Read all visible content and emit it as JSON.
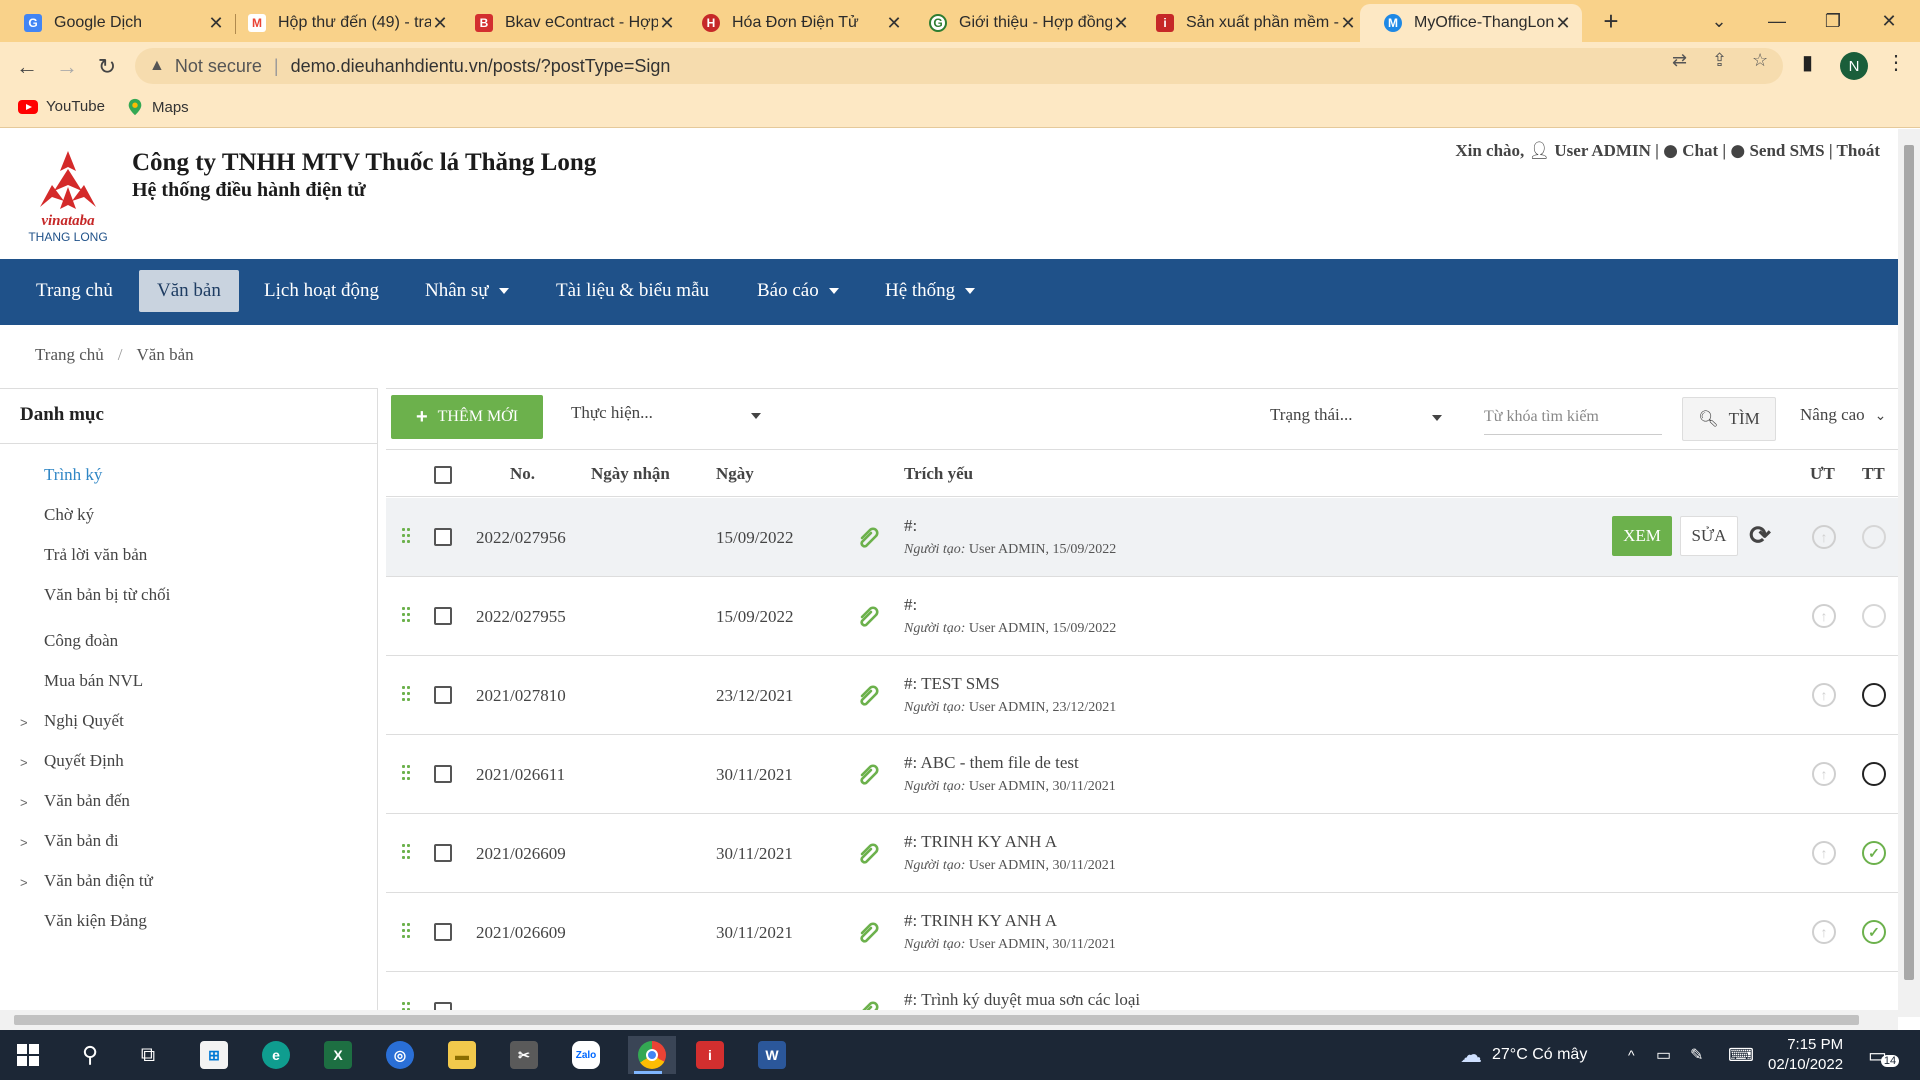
{
  "browser": {
    "tabs": [
      {
        "title": "Google Dịch",
        "color": "#4285f4",
        "icon": "G"
      },
      {
        "title": "Hộp thư đến (49) - tra",
        "color": "#ea4335",
        "icon": "M"
      },
      {
        "title": "Bkav eContract - Hợp",
        "color": "#d32f2f",
        "icon": "B"
      },
      {
        "title": "Hóa Đơn Điện Tử",
        "color": "#c62828",
        "icon": "H"
      },
      {
        "title": "Giới thiệu - Hợp đồng",
        "color": "#2e7d32",
        "icon": "G"
      },
      {
        "title": "Sản xuất phần mềm -",
        "color": "#c62828",
        "icon": "i"
      },
      {
        "title": "MyOffice-ThangLong",
        "color": "#1e88e5",
        "icon": "M"
      }
    ],
    "new_tab": "+",
    "not_secure": "Not secure",
    "url": "demo.dieuhanhdientu.vn/posts/?postType=Sign",
    "profile_initial": "N",
    "bookmarks": [
      {
        "label": "YouTube"
      },
      {
        "label": "Maps"
      }
    ]
  },
  "header": {
    "company": "Công ty TNHH MTV Thuốc lá Thăng Long",
    "system": "Hệ thống điều hành điện tử",
    "logo_brand": "vinataba",
    "logo_sub": "THANG LONG",
    "greeting": "Xin chào,",
    "user": "User ADMIN",
    "chat": "Chat",
    "send_sms": "Send SMS",
    "logout": "Thoát"
  },
  "nav": {
    "items": [
      {
        "label": "Trang chủ"
      },
      {
        "label": "Văn bản"
      },
      {
        "label": "Lịch hoạt động"
      },
      {
        "label": "Nhân sự"
      },
      {
        "label": "Tài liệu & biểu mẫu"
      },
      {
        "label": "Báo cáo"
      },
      {
        "label": "Hệ thống"
      }
    ]
  },
  "breadcrumb": {
    "home": "Trang chủ",
    "sep": "/",
    "current": "Văn bản"
  },
  "sidebar": {
    "title": "Danh mục",
    "items": [
      {
        "label": "Trình ký"
      },
      {
        "label": "Chờ ký"
      },
      {
        "label": "Trả lời văn bản"
      },
      {
        "label": "Văn bản bị từ chối"
      },
      {
        "label": "Công đoàn"
      },
      {
        "label": "Mua bán NVL"
      },
      {
        "label": "Nghị Quyết"
      },
      {
        "label": "Quyết Định"
      },
      {
        "label": "Văn bản đến"
      },
      {
        "label": "Văn bản đi"
      },
      {
        "label": "Văn bản điện tử"
      },
      {
        "label": "Văn kiện Đảng"
      }
    ]
  },
  "toolbar": {
    "add_label": "THÊM MỚI",
    "thuchien_placeholder": "Thực hiện...",
    "trangthai_placeholder": "Trạng thái...",
    "search_placeholder": "Từ khóa tìm kiếm",
    "search_label": "TÌM",
    "advanced_label": "Nâng cao"
  },
  "table": {
    "headers": {
      "no": "No.",
      "ngay_nhan": "Ngày nhận",
      "ngay": "Ngày",
      "trich_yeu": "Trích yếu",
      "ut": "ƯT",
      "tt": "TT"
    },
    "creator_label": "Người tạo:",
    "view_label": "XEM",
    "edit_label": "SỬA",
    "rows": [
      {
        "no": "2022/027956",
        "date": "15/09/2022",
        "trich_yeu": "#:",
        "meta": "User ADMIN, 15/09/2022",
        "status": "empty"
      },
      {
        "no": "2022/027955",
        "date": "15/09/2022",
        "trich_yeu": "#:",
        "meta": "User ADMIN, 15/09/2022",
        "status": "empty"
      },
      {
        "no": "2021/027810",
        "date": "23/12/2021",
        "trich_yeu": "#: TEST SMS",
        "meta": "User ADMIN, 23/12/2021",
        "status": "dark"
      },
      {
        "no": "2021/026611",
        "date": "30/11/2021",
        "trich_yeu": "#: ABC - them file de test",
        "meta": "User ADMIN, 30/11/2021",
        "status": "dark"
      },
      {
        "no": "2021/026609",
        "date": "30/11/2021",
        "trich_yeu": "#: TRINH KY ANH A",
        "meta": "User ADMIN, 30/11/2021",
        "status": "check"
      },
      {
        "no": "2021/026609",
        "date": "30/11/2021",
        "trich_yeu": "#: TRINH KY ANH A",
        "meta": "User ADMIN, 30/11/2021",
        "status": "check"
      },
      {
        "trich_yeu": "#: Trình ký duyệt mua sơn các loại"
      }
    ]
  },
  "taskbar": {
    "weather": "27°C Có mây",
    "time": "7:15 PM",
    "date": "02/10/2022",
    "notifications": "14"
  }
}
